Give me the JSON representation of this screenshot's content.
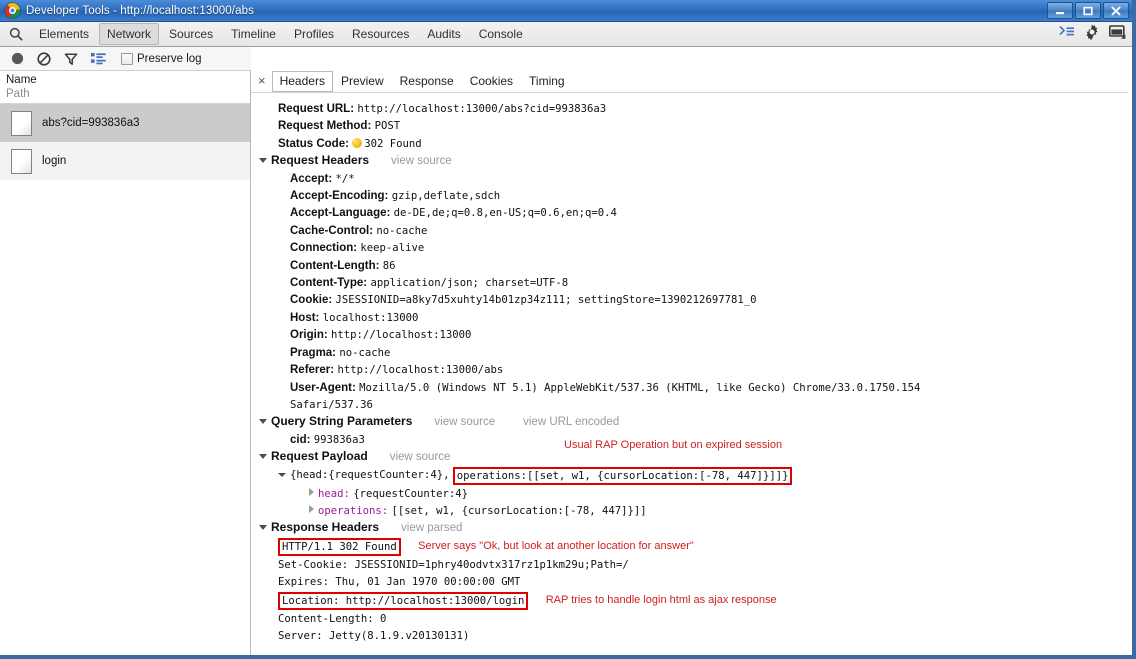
{
  "window": {
    "title": "Developer Tools - http://localhost:13000/abs",
    "icon": "chrome-logo-icon",
    "buttons": {
      "minimize": "–",
      "maximize": "❐",
      "close": "✕"
    }
  },
  "devtools_tabs": {
    "search_icon": "search-icon",
    "items": [
      {
        "label": "Elements",
        "active": false
      },
      {
        "label": "Network",
        "active": true
      },
      {
        "label": "Sources",
        "active": false
      },
      {
        "label": "Timeline",
        "active": false
      },
      {
        "label": "Profiles",
        "active": false
      },
      {
        "label": "Resources",
        "active": false
      },
      {
        "label": "Audits",
        "active": false
      },
      {
        "label": "Console",
        "active": false
      }
    ],
    "right_icons": [
      "dock-console-icon",
      "settings-gear-icon",
      "dock-position-icon"
    ]
  },
  "network_toolbar": {
    "record_icon": "record-circle-icon",
    "clear_icon": "clear-prohibited-icon",
    "filter_icon": "filter-funnel-icon",
    "group_icon": "list-view-icon",
    "preserve_log_label": "Preserve log",
    "preserve_log_checked": false
  },
  "requests_list": {
    "columns": {
      "name": "Name",
      "path": "Path"
    },
    "rows": [
      {
        "label": "abs?cid=993836a3",
        "selected": true
      },
      {
        "label": "login",
        "selected": false
      }
    ]
  },
  "details": {
    "close_label": "×",
    "tabs": [
      {
        "label": "Headers",
        "active": true
      },
      {
        "label": "Preview",
        "active": false
      },
      {
        "label": "Response",
        "active": false
      },
      {
        "label": "Cookies",
        "active": false
      },
      {
        "label": "Timing",
        "active": false
      }
    ],
    "general": [
      {
        "name": "Request URL:",
        "value": "http://localhost:13000/abs?cid=993836a3"
      },
      {
        "name": "Request Method:",
        "value": "POST"
      }
    ],
    "status": {
      "name": "Status Code:",
      "value": "302 Found",
      "dot": "orange-status-dot"
    },
    "request_headers": {
      "section": "Request Headers",
      "view_source": "view source",
      "items": [
        {
          "name": "Accept:",
          "value": "*/*"
        },
        {
          "name": "Accept-Encoding:",
          "value": "gzip,deflate,sdch"
        },
        {
          "name": "Accept-Language:",
          "value": "de-DE,de;q=0.8,en-US;q=0.6,en;q=0.4"
        },
        {
          "name": "Cache-Control:",
          "value": "no-cache"
        },
        {
          "name": "Connection:",
          "value": "keep-alive"
        },
        {
          "name": "Content-Length:",
          "value": "86"
        },
        {
          "name": "Content-Type:",
          "value": "application/json; charset=UTF-8"
        },
        {
          "name": "Cookie:",
          "value": "JSESSIONID=a8ky7d5xuhty14b01zp34z111; settingStore=1390212697781_0"
        },
        {
          "name": "Host:",
          "value": "localhost:13000"
        },
        {
          "name": "Origin:",
          "value": "http://localhost:13000"
        },
        {
          "name": "Pragma:",
          "value": "no-cache"
        },
        {
          "name": "Referer:",
          "value": "http://localhost:13000/abs"
        },
        {
          "name": "User-Agent:",
          "value": "Mozilla/5.0 (Windows NT 5.1) AppleWebKit/537.36 (KHTML, like Gecko) Chrome/33.0.1750.154"
        }
      ],
      "user_agent_wrap": "Safari/537.36"
    },
    "query_string": {
      "section": "Query String Parameters",
      "view_source": "view source",
      "view_url_encoded": "view URL encoded",
      "items": [
        {
          "name": "cid:",
          "value": "993836a3"
        }
      ]
    },
    "request_payload": {
      "section": "Request Payload",
      "view_source": "view source",
      "root_prefix": "{head:{requestCounter:4},",
      "root_highlight": "operations:[[set, w1, {cursorLocation:[-78, 447]}]]}",
      "children": [
        {
          "key": "head:",
          "value": "{requestCounter:4}"
        },
        {
          "key": "operations:",
          "value": "[[set, w1, {cursorLocation:[-78, 447]}]]"
        }
      ]
    },
    "response_headers": {
      "section": "Response Headers",
      "view_parsed": "view parsed",
      "status_line": "HTTP/1.1 302 Found",
      "items": [
        {
          "text": "Set-Cookie: JSESSIONID=1phry40odvtx317rz1p1km29u;Path=/",
          "highlight": false
        },
        {
          "text": "Expires: Thu, 01 Jan 1970 00:00:00 GMT",
          "highlight": false
        },
        {
          "text": "Location: http://localhost:13000/login",
          "highlight": true
        },
        {
          "text": "Content-Length: 0",
          "highlight": false
        },
        {
          "text": "Server: Jetty(8.1.9.v20130131)",
          "highlight": false
        }
      ]
    },
    "annotations": [
      {
        "text": "Usual RAP Operation but on expired session"
      },
      {
        "text": "Server says \"Ok, but look at another location for answer\""
      },
      {
        "text": "RAP tries to handle login html as ajax response"
      }
    ]
  },
  "colors": {
    "annotation_red": "#d02020",
    "highlight_box_red": "#e00000",
    "json_key_purple": "#9b1f9b",
    "status_orange": "#f0b400",
    "titlebar_blue": "#2f6fbe",
    "selected_row_gray": "#cbcbcb"
  }
}
